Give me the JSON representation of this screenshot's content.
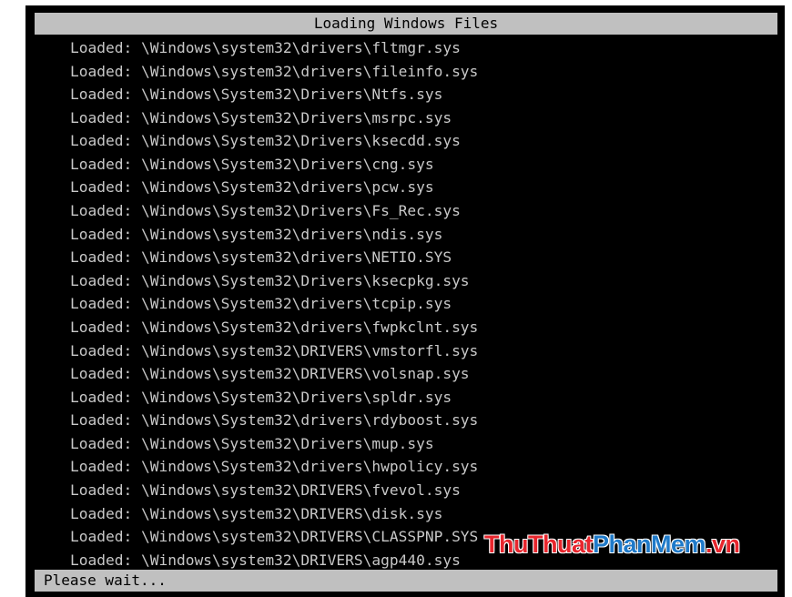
{
  "header": {
    "title": "Loading Windows Files"
  },
  "files": [
    "Loaded: \\Windows\\system32\\drivers\\fltmgr.sys",
    "Loaded: \\Windows\\system32\\drivers\\fileinfo.sys",
    "Loaded: \\Windows\\System32\\Drivers\\Ntfs.sys",
    "Loaded: \\Windows\\System32\\Drivers\\msrpc.sys",
    "Loaded: \\Windows\\System32\\Drivers\\ksecdd.sys",
    "Loaded: \\Windows\\System32\\Drivers\\cng.sys",
    "Loaded: \\Windows\\System32\\drivers\\pcw.sys",
    "Loaded: \\Windows\\System32\\Drivers\\Fs_Rec.sys",
    "Loaded: \\Windows\\system32\\drivers\\ndis.sys",
    "Loaded: \\Windows\\system32\\drivers\\NETIO.SYS",
    "Loaded: \\Windows\\System32\\Drivers\\ksecpkg.sys",
    "Loaded: \\Windows\\System32\\drivers\\tcpip.sys",
    "Loaded: \\Windows\\System32\\drivers\\fwpkclnt.sys",
    "Loaded: \\Windows\\system32\\DRIVERS\\vmstorfl.sys",
    "Loaded: \\Windows\\system32\\DRIVERS\\volsnap.sys",
    "Loaded: \\Windows\\System32\\Drivers\\spldr.sys",
    "Loaded: \\Windows\\System32\\drivers\\rdyboost.sys",
    "Loaded: \\Windows\\System32\\Drivers\\mup.sys",
    "Loaded: \\Windows\\System32\\drivers\\hwpolicy.sys",
    "Loaded: \\Windows\\system32\\DRIVERS\\fvevol.sys",
    "Loaded: \\Windows\\system32\\DRIVERS\\disk.sys",
    "Loaded: \\Windows\\system32\\DRIVERS\\CLASSPNP.SYS",
    "Loaded: \\Windows\\system32\\DRIVERS\\agp440.sys"
  ],
  "status": {
    "text": "Please wait..."
  },
  "watermark": {
    "part1": "Thu",
    "part2": "Thuat",
    "part3": "Phan",
    "part4": "Mem",
    "part5": ".vn"
  },
  "colors": {
    "screen_background": "#000000",
    "bar_background": "#c0c0c0",
    "bar_text": "#000000",
    "list_text": "#c8c8c8",
    "watermark_red": "#e8262d",
    "watermark_blue": "#1f7ac9"
  }
}
